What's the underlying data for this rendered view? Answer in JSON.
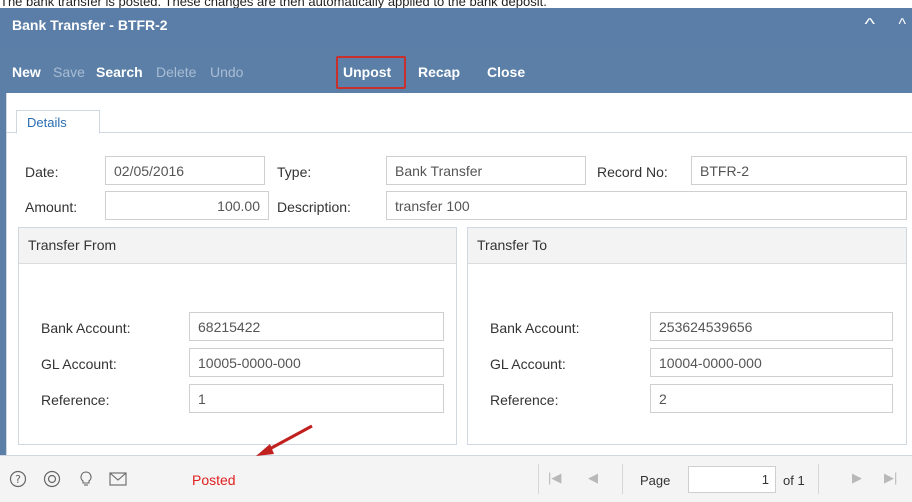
{
  "caption": "The bank transfer is posted. These changes are then automatically applied to the bank deposit.",
  "window": {
    "title": "Bank Transfer - BTFR-2"
  },
  "toolbar": {
    "new": "New",
    "save": "Save",
    "search": "Search",
    "delete": "Delete",
    "undo": "Undo",
    "unpost": "Unpost",
    "recap": "Recap",
    "close": "Close"
  },
  "tabs": {
    "details": "Details"
  },
  "form": {
    "date_label": "Date:",
    "date_value": "02/05/2016",
    "type_label": "Type:",
    "type_value": "Bank Transfer",
    "record_label": "Record No:",
    "record_value": "BTFR-2",
    "amount_label": "Amount:",
    "amount_value": "100.00",
    "description_label": "Description:",
    "description_value": "transfer 100"
  },
  "transfer_from": {
    "title": "Transfer From",
    "bank_account_label": "Bank Account:",
    "bank_account_value": "68215422",
    "gl_account_label": "GL Account:",
    "gl_account_value": "10005-0000-000",
    "reference_label": "Reference:",
    "reference_value": "1"
  },
  "transfer_to": {
    "title": "Transfer To",
    "bank_account_label": "Bank Account:",
    "bank_account_value": "253624539656",
    "gl_account_label": "GL Account:",
    "gl_account_value": "10004-0000-000",
    "reference_label": "Reference:",
    "reference_value": "2"
  },
  "statusbar": {
    "status": "Posted",
    "page_label": "Page",
    "page_value": "1",
    "of_label": "of 1"
  },
  "colors": {
    "header_bg": "#5b7fa6",
    "posted_text": "#e02020",
    "highlight_border": "#c9302c"
  }
}
